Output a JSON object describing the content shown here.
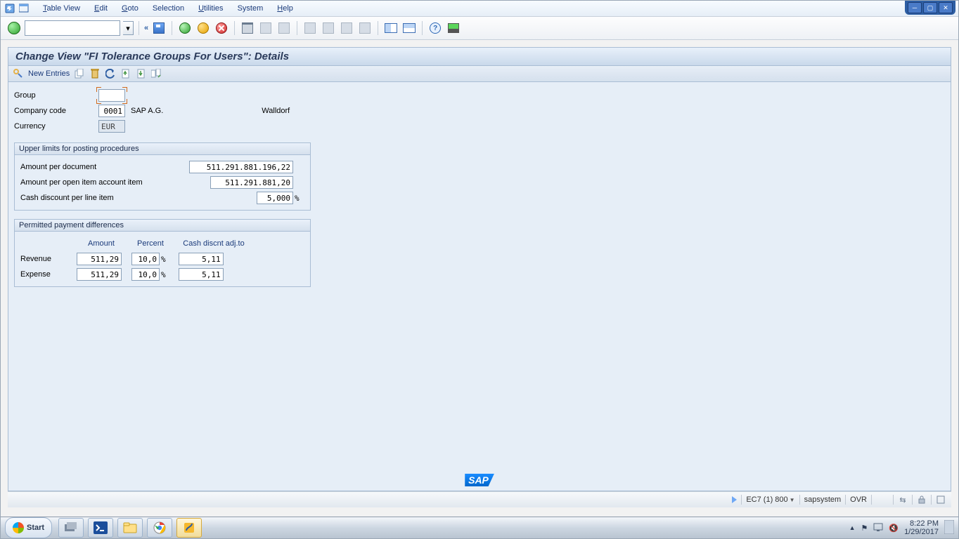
{
  "menu": {
    "table_view": "Table View",
    "edit": "Edit",
    "goto": "Goto",
    "selection": "Selection",
    "utilities": "Utilities",
    "system": "System",
    "help": "Help"
  },
  "toolbar": {
    "doublearrow": "«"
  },
  "title": "Change View \"FI Tolerance Groups For Users\": Details",
  "apptb": {
    "new_entries": "New Entries"
  },
  "fields": {
    "group_label": "Group",
    "group_value": "",
    "company_label": "Company code",
    "company_value": "0001",
    "company_name": "SAP A.G.",
    "company_city": "Walldorf",
    "currency_label": "Currency",
    "currency_value": "EUR"
  },
  "section1": {
    "title": "Upper limits for posting procedures",
    "r1_label": "Amount per document",
    "r1_value": "511.291.881.196,22",
    "r2_label": "Amount per open item account item",
    "r2_value": "511.291.881,20",
    "r3_label": "Cash discount per line item",
    "r3_value": "5,000",
    "r3_unit": "%"
  },
  "section2": {
    "title": "Permitted payment differences",
    "col_amount": "Amount",
    "col_percent": "Percent",
    "col_cash": "Cash discnt adj.to",
    "row_rev": "Revenue",
    "rev_amount": "511,29",
    "rev_percent": "10,0",
    "rev_cash": "5,11",
    "row_exp": "Expense",
    "exp_amount": "511,29",
    "exp_percent": "10,0",
    "exp_cash": "5,11",
    "pct": "%"
  },
  "logo": "SAP",
  "status": {
    "system": "EC7 (1) 800",
    "host": "sapsystem",
    "mode": "OVR"
  },
  "taskbar": {
    "start": "Start",
    "time": "8:22 PM",
    "date": "1/29/2017"
  }
}
